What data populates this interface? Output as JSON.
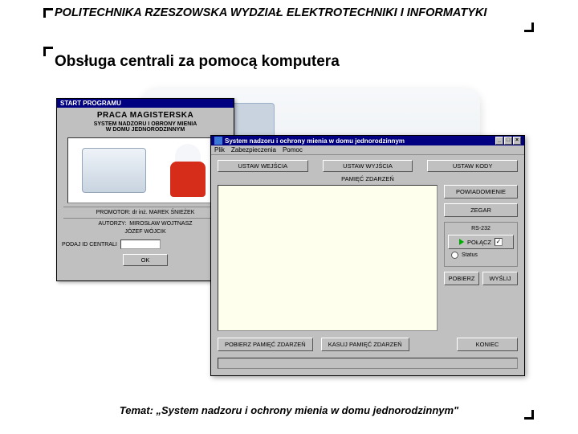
{
  "header": "POLITECHNIKA RZESZOWSKA WYDZIAŁ ELEKTROTECHNIKI I INFORMATYKI",
  "title": "Obsługa centrali za pomocą komputera",
  "footer": "Temat: „System nadzoru i ochrony mienia w domu jednorodzinnym\"",
  "win1": {
    "titlebar": "START PROGRAMU",
    "h1": "PRACA MAGISTERSKA",
    "h2a": "SYSTEM NADZORU I OBRONY MIENIA",
    "h2b": "W DOMU JEDNORODZINNYM",
    "promotor": "PROMOTOR: dr inż. MAREK ŚNIEŻEK",
    "autorzy_label": "AUTORZY:",
    "autor1": "MIROSŁAW WOJTNASZ",
    "autor2": "JÓZEF WÓJCIK",
    "input_label": "PODAJ ID CENTRALI",
    "ok": "OK"
  },
  "win2": {
    "titlebar": "System nadzoru i ochrony mienia w domu jednorodzinnym",
    "menu": [
      "Plik",
      "Zabezpieczenia",
      "Pomoc"
    ],
    "btn_in": "USTAW WEJŚCIA",
    "btn_out": "USTAW WYJŚCIA",
    "btn_codes": "USTAW KODY",
    "events_label": "PAMIĘĆ ZDARZEŃ",
    "btn_notify": "POWIADOMIENIE",
    "btn_clock": "ZEGAR",
    "panel_title": "RS-232",
    "chk_connect": "POŁĄCZ",
    "radio_status": "Status",
    "btn_get": "POBIERZ",
    "btn_send": "WYŚLIJ",
    "btn_get_events": "POBIERZ PAMIĘĆ ZDARZEŃ",
    "btn_clear_events": "KASUJ PAMIĘĆ ZDARZEŃ",
    "btn_exit": "KONIEC"
  }
}
